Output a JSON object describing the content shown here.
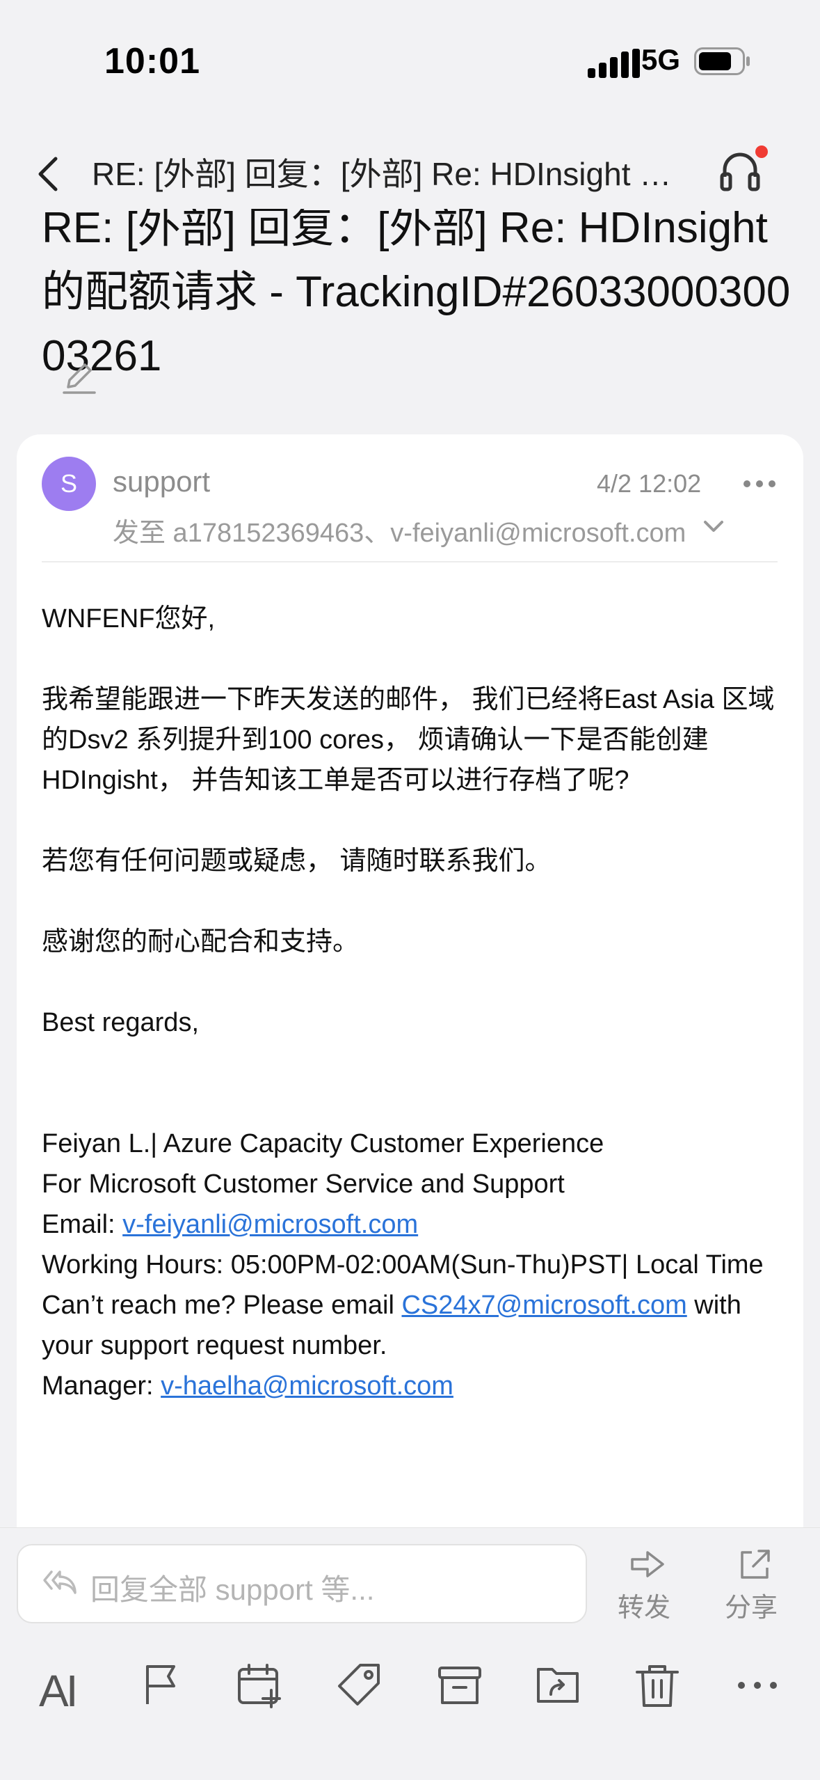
{
  "status_bar": {
    "time": "10:01",
    "network": "5G"
  },
  "nav": {
    "title": "RE: [外部] 回复：[外部] Re: HDInsight 的配额请求 - TrackingID#2603300030003261"
  },
  "subject": "RE: [外部] 回复：[外部] Re: HDInsight 的配额请求 - TrackingID#2603300030003261",
  "message": {
    "avatar_letter": "S",
    "sender": "support",
    "date": "4/2 12:02",
    "recipients": "发至 a178152369463、v-feiyanli@microsoft.com",
    "body": {
      "greeting": "WNFENF您好,",
      "para1": "我希望能跟进一下昨天发送的邮件， 我们已经将East Asia 区域的Dsv2 系列提升到100 cores， 烦请确认一下是否能创建HDIngisht， 并告知该工单是否可以进行存档了呢?",
      "para2": "若您有任何问题或疑虑， 请随时联系我们。",
      "para3": "感谢您的耐心配合和支持。",
      "closing": "Best regards,",
      "sig_name": "Feiyan L.| Azure Capacity Customer Experience",
      "sig_org": "For Microsoft Customer Service and Support",
      "email_label": "Email: ",
      "email_link": "v-feiyanli@microsoft.com",
      "hours": "Working Hours: 05:00PM-02:00AM(Sun-Thu)PST| Local Time",
      "reach_prefix": "Can’t reach me? Please email ",
      "reach_link": "CS24x7@microsoft.com",
      "reach_suffix": " with your support request number.",
      "manager_label": "Manager: ",
      "manager_link": "v-haelha@microsoft.com"
    }
  },
  "reply_bar": {
    "placeholder": "回复全部  support 等...",
    "forward_label": "转发",
    "share_label": "分享"
  },
  "toolbar": {
    "ai_label": "AI"
  },
  "colors": {
    "link": "#2a73d9",
    "avatar": "#9d7df0",
    "notification_dot": "#f03b33"
  },
  "icons": [
    "back-chevron-icon",
    "headset-icon",
    "edit-icon",
    "more-icon",
    "expand-chevron-icon",
    "reply-all-icon",
    "forward-icon",
    "share-icon",
    "flag-icon",
    "calendar-add-icon",
    "tag-icon",
    "archive-icon",
    "move-folder-icon",
    "trash-icon"
  ]
}
